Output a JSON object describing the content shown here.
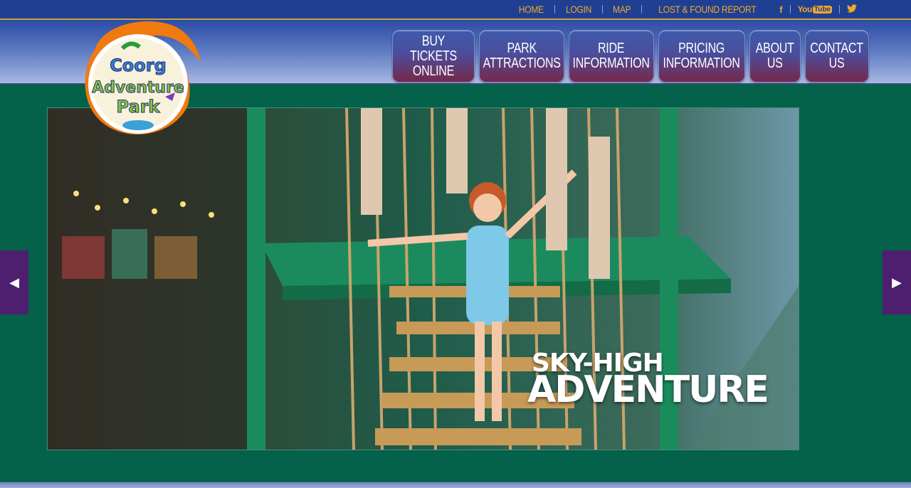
{
  "top_links": [
    "HOME",
    "LOGIN",
    "MAP",
    "LOST & FOUND REPORT"
  ],
  "social": {
    "facebook": "f",
    "youtube_you": "You",
    "youtube_tube": "Tube",
    "twitter": "t"
  },
  "logo": {
    "line1": "Coorg",
    "line2": "Adventure",
    "line3": "Park"
  },
  "nav": [
    {
      "label": "BUY TICKETS\nONLINE"
    },
    {
      "label": "PARK\nATTRACTIONS"
    },
    {
      "label": "RIDE\nINFORMATION"
    },
    {
      "label": "PRICING\nINFORMATION"
    },
    {
      "label": "ABOUT\nUS"
    },
    {
      "label": "CONTACT\nUS"
    }
  ],
  "slider": {
    "caption_line1": "SKY-HIGH",
    "caption_line2": "ADVENTURE",
    "prev": "◀",
    "next": "▶"
  },
  "colors": {
    "topbar": "#1f3f93",
    "link": "#f0a829",
    "page_bg": "#04614a",
    "arrow_bg": "#4e1f6e"
  }
}
